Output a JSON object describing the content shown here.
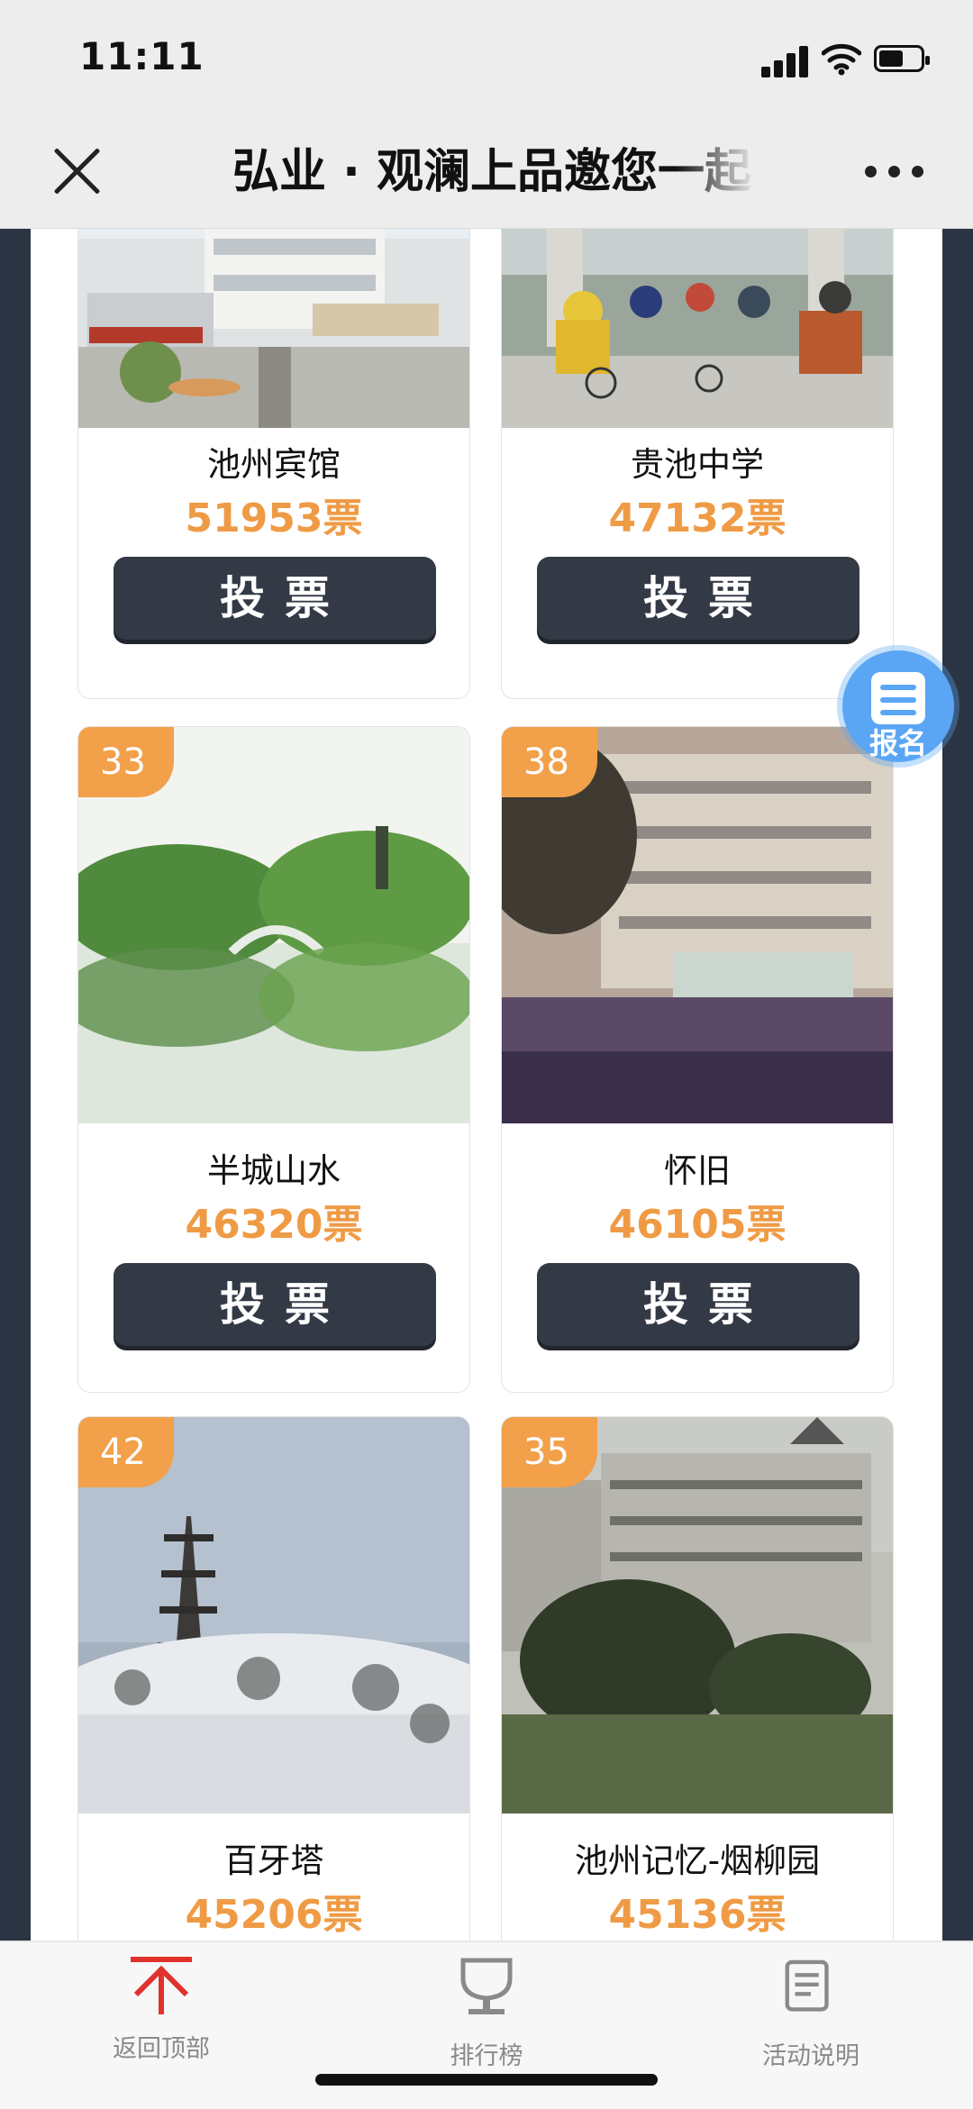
{
  "status": {
    "time": "11:11"
  },
  "nav": {
    "title": "弘业 · 观澜上品邀您一起"
  },
  "signup": {
    "label": "报名"
  },
  "vote_label": "投票",
  "cards": [
    {
      "name": "池州宾馆",
      "votes": "51953票",
      "rank": ""
    },
    {
      "name": "贵池中学",
      "votes": "47132票",
      "rank": ""
    },
    {
      "name": "半城山水",
      "votes": "46320票",
      "rank": "33"
    },
    {
      "name": "怀旧",
      "votes": "46105票",
      "rank": "38"
    },
    {
      "name": "百牙塔",
      "votes": "45206票",
      "rank": "42"
    },
    {
      "name": "池州记忆-烟柳园",
      "votes": "45136票",
      "rank": "35"
    }
  ],
  "tabs": [
    {
      "label": "返回顶部",
      "icon": "arrow-up-to-top-icon",
      "color": "#e0322d"
    },
    {
      "label": "排行榜",
      "icon": "trophy-icon"
    },
    {
      "label": "活动说明",
      "icon": "document-icon"
    }
  ],
  "colors": {
    "accent_orange": "#ef9b45",
    "button_dark": "#333a46",
    "page_frame": "#2b3442",
    "signup_blue": "#5aa6f4"
  }
}
